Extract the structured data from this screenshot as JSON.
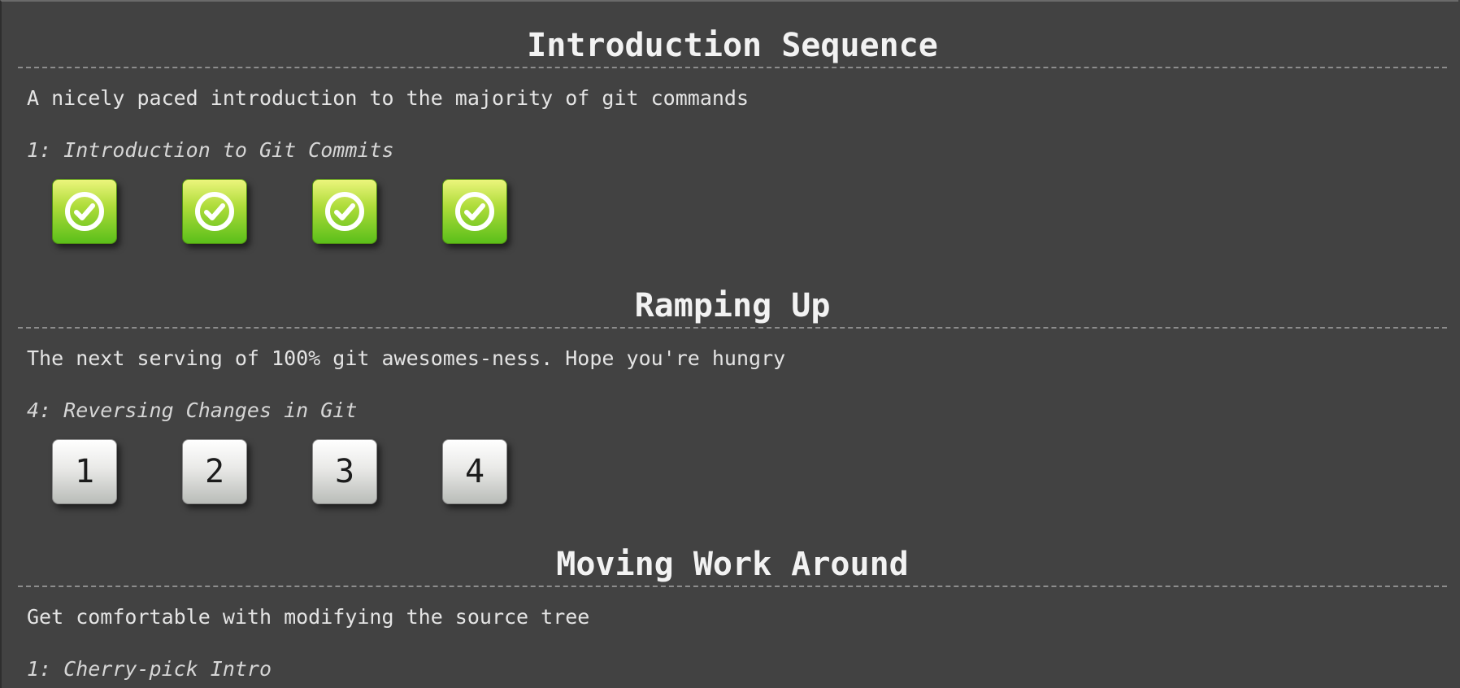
{
  "sequences": [
    {
      "title": "Introduction Sequence",
      "about": "A nicely paced introduction to the majority of git commands",
      "current_level": "1: Introduction to Git Commits",
      "levels": [
        {
          "state": "solved",
          "label": ""
        },
        {
          "state": "solved",
          "label": ""
        },
        {
          "state": "solved",
          "label": ""
        },
        {
          "state": "solved",
          "label": ""
        }
      ]
    },
    {
      "title": "Ramping Up",
      "about": "The next serving of 100% git awesomes-ness. Hope you're hungry",
      "current_level": "4: Reversing Changes in Git",
      "levels": [
        {
          "state": "unsolved",
          "label": "1"
        },
        {
          "state": "unsolved",
          "label": "2"
        },
        {
          "state": "unsolved",
          "label": "3"
        },
        {
          "state": "unsolved",
          "label": "4"
        }
      ]
    },
    {
      "title": "Moving Work Around",
      "about": "Get comfortable with modifying the source tree",
      "current_level": "1: Cherry-pick Intro",
      "levels": []
    }
  ],
  "colors": {
    "background": "#424242",
    "solved_green": "#5bbf1a",
    "unsolved_gray": "#e9e9e7"
  },
  "icons": {
    "solved": "check-circle-icon"
  }
}
